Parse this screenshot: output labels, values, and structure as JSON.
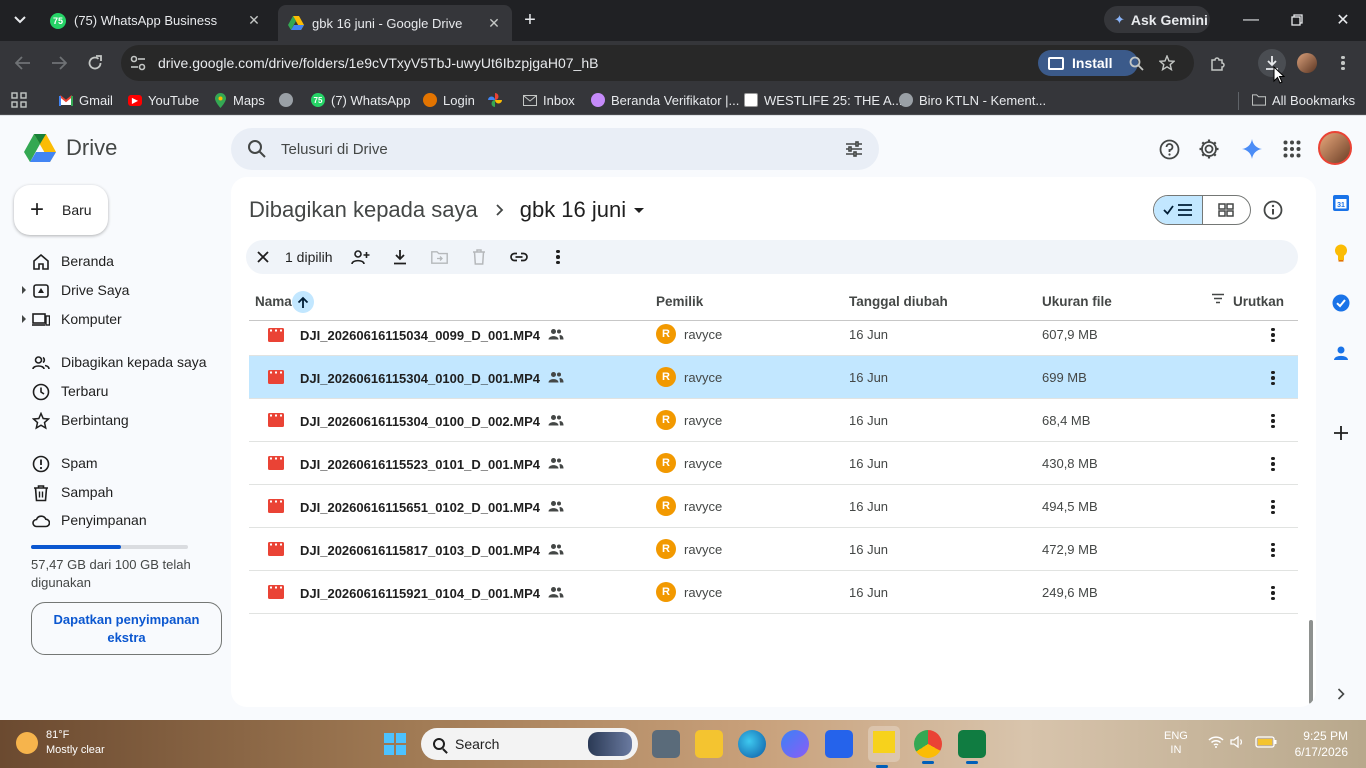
{
  "browser": {
    "tabs": [
      {
        "label": "(75) WhatsApp Business",
        "favicon_badge": "75",
        "active": false
      },
      {
        "label": "gbk 16 juni - Google Drive",
        "active": true
      }
    ],
    "gemini_label": "Ask Gemini",
    "url": "drive.google.com/drive/folders/1e9cVTxyV5TbJ-uwyUt6IbzpjgaH07_hB",
    "install_label": "Install",
    "bookmarks": [
      {
        "label": "Gmail",
        "icon": "gmail-icon",
        "color": "#ea4335"
      },
      {
        "label": "YouTube",
        "icon": "youtube-icon",
        "color": "#ff0000"
      },
      {
        "label": "Maps",
        "icon": "maps-icon",
        "color": "#34a853"
      },
      {
        "label": "",
        "icon": "globe-icon",
        "color": "#9aa0a6"
      },
      {
        "label": "(7) WhatsApp",
        "icon": "whatsapp-icon",
        "color": "#25d366",
        "badge": "75"
      },
      {
        "label": "Login",
        "icon": "login-icon",
        "color": "#e37400"
      },
      {
        "label": "",
        "icon": "pinwheel-icon",
        "color": "#fbbc04"
      },
      {
        "label": "Inbox",
        "icon": "mail-icon",
        "color": "#9aa0a6"
      },
      {
        "label": "Beranda Verifikator |...",
        "icon": "verifikator-icon",
        "color": "#c58af9"
      },
      {
        "label": "WESTLIFE 25: THE A...",
        "icon": "westlife-icon",
        "color": "#ffffff"
      },
      {
        "label": "Biro KTLN - Kement...",
        "icon": "globe-icon",
        "color": "#9aa0a6"
      }
    ],
    "all_bookmarks_label": "All Bookmarks"
  },
  "drive": {
    "app_name": "Drive",
    "search_placeholder": "Telusuri di Drive",
    "new_label": "Baru",
    "nav": [
      {
        "label": "Beranda",
        "icon": "home-icon",
        "expandable": false
      },
      {
        "label": "Drive Saya",
        "icon": "my-drive-icon",
        "expandable": true
      },
      {
        "label": "Komputer",
        "icon": "computer-icon",
        "expandable": true
      },
      {
        "label": "Dibagikan kepada saya",
        "icon": "shared-icon",
        "expandable": false
      },
      {
        "label": "Terbaru",
        "icon": "clock-icon",
        "expandable": false
      },
      {
        "label": "Berbintang",
        "icon": "star-icon",
        "expandable": false
      },
      {
        "label": "Spam",
        "icon": "spam-icon",
        "expandable": false
      },
      {
        "label": "Sampah",
        "icon": "trash-icon",
        "expandable": false
      },
      {
        "label": "Penyimpanan",
        "icon": "cloud-icon",
        "expandable": false
      }
    ],
    "storage": {
      "used_fraction": 0.5747,
      "text": "57,47 GB dari 100 GB telah digunakan",
      "button_label": "Dapatkan penyimpanan ekstra"
    },
    "breadcrumb": {
      "parent": "Dibagikan kepada saya",
      "current": "gbk 16 juni"
    },
    "selection": {
      "count_label": "1 dipilih"
    },
    "columns": {
      "name": "Nama",
      "owner": "Pemilik",
      "modified": "Tanggal diubah",
      "size": "Ukuran file",
      "sort": "Urutkan"
    },
    "files": [
      {
        "name": "DJI_20260616115034_0099_D_001.MP4",
        "owner_initial": "R",
        "owner": "ravyce",
        "modified": "16 Jun",
        "size": "607,9 MB",
        "selected": false
      },
      {
        "name": "DJI_20260616115304_0100_D_001.MP4",
        "owner_initial": "R",
        "owner": "ravyce",
        "modified": "16 Jun",
        "size": "699 MB",
        "selected": true
      },
      {
        "name": "DJI_20260616115304_0100_D_002.MP4",
        "owner_initial": "R",
        "owner": "ravyce",
        "modified": "16 Jun",
        "size": "68,4 MB",
        "selected": false
      },
      {
        "name": "DJI_20260616115523_0101_D_001.MP4",
        "owner_initial": "R",
        "owner": "ravyce",
        "modified": "16 Jun",
        "size": "430,8 MB",
        "selected": false
      },
      {
        "name": "DJI_20260616115651_0102_D_001.MP4",
        "owner_initial": "R",
        "owner": "ravyce",
        "modified": "16 Jun",
        "size": "494,5 MB",
        "selected": false
      },
      {
        "name": "DJI_20260616115817_0103_D_001.MP4",
        "owner_initial": "R",
        "owner": "ravyce",
        "modified": "16 Jun",
        "size": "472,9 MB",
        "selected": false
      },
      {
        "name": "DJI_20260616115921_0104_D_001.MP4",
        "owner_initial": "R",
        "owner": "ravyce",
        "modified": "16 Jun",
        "size": "249,6 MB",
        "selected": false
      }
    ],
    "colors": {
      "accent": "#0b57d0",
      "selected_row": "#c2e7ff",
      "video_icon": "#ea4335",
      "owner_avatar": "#f29900"
    }
  },
  "taskbar": {
    "weather_temp": "81°F",
    "weather_desc": "Mostly clear",
    "search_label": "Search",
    "lang_top": "ENG",
    "lang_bottom": "IN",
    "time": "9:25 PM",
    "date": "6/17/2026"
  }
}
